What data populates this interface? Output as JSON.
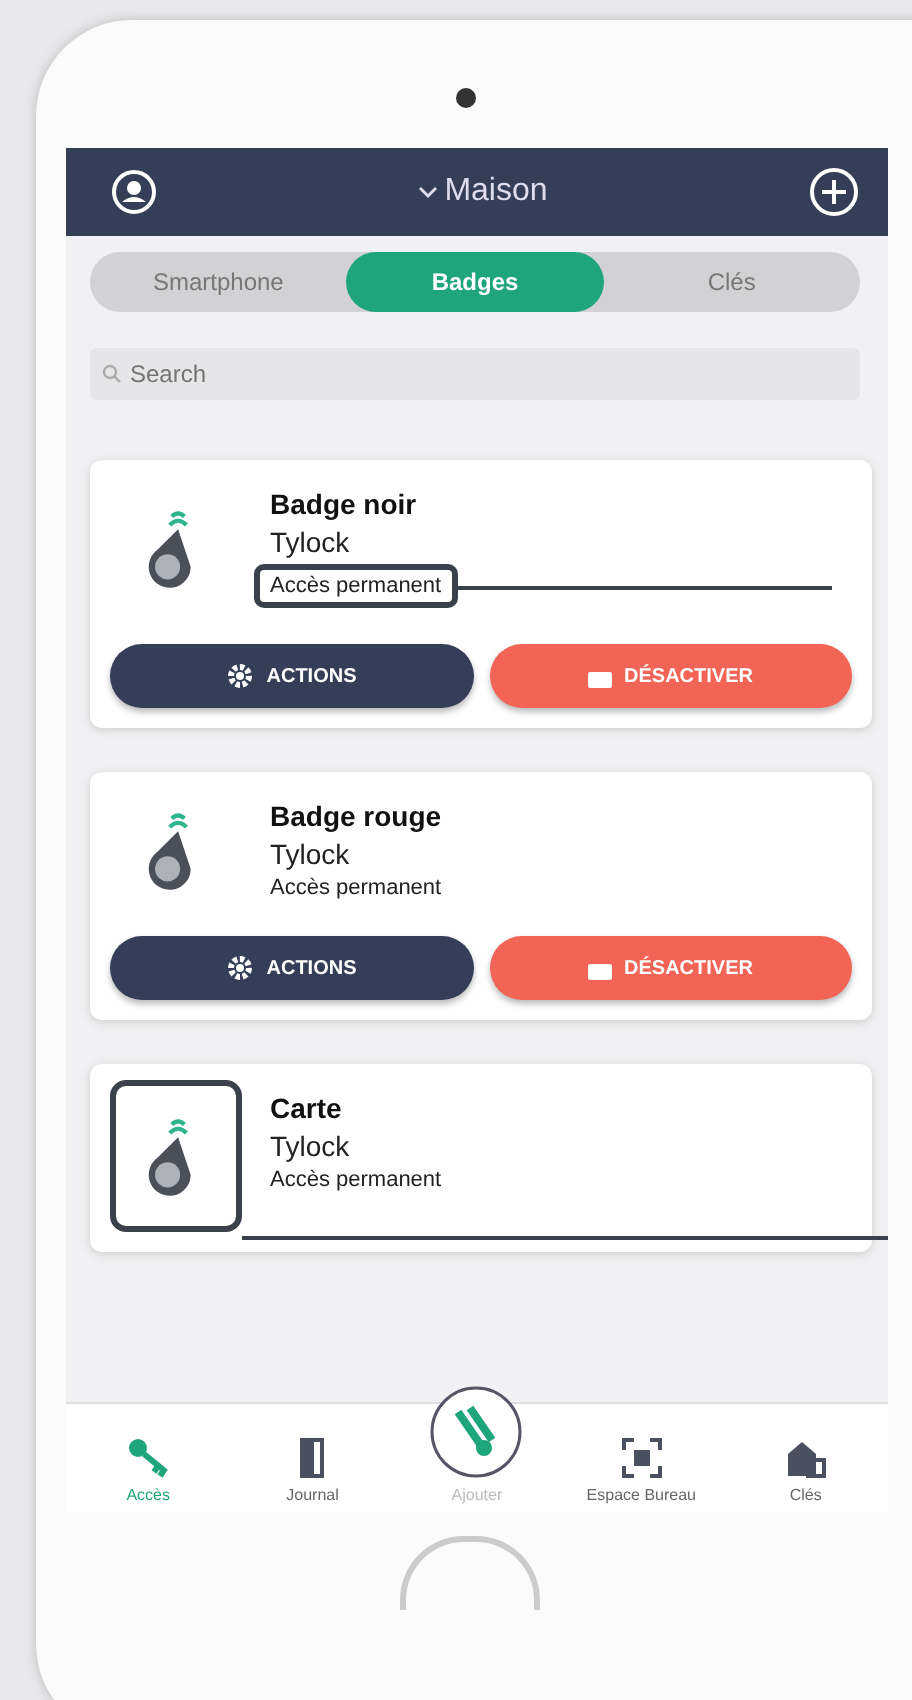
{
  "header": {
    "title": "Maison"
  },
  "tabs": [
    {
      "label": "Smartphone",
      "selected": false
    },
    {
      "label": "Badges",
      "selected": true
    },
    {
      "label": "Clés",
      "selected": false
    }
  ],
  "search": {
    "placeholder": "Search"
  },
  "cards": [
    {
      "name": "Badge noir",
      "brand": "Tylock",
      "access": "Accès permanent",
      "access_highlighted": true,
      "icon_highlighted": false,
      "buttons": [
        {
          "kind": "actions",
          "label": "ACTIONS"
        },
        {
          "kind": "deactivate",
          "label": "DÉSACTIVER"
        }
      ]
    },
    {
      "name": "Badge rouge",
      "brand": "Tylock",
      "access": "Accès permanent",
      "access_highlighted": false,
      "icon_highlighted": false,
      "buttons": [
        {
          "kind": "actions",
          "label": "ACTIONS"
        },
        {
          "kind": "deactivate",
          "label": "DÉSACTIVER"
        }
      ]
    },
    {
      "name": "Carte",
      "brand": "Tylock",
      "access": "Accès permanent",
      "access_highlighted": false,
      "icon_highlighted": true
    }
  ],
  "nav": [
    {
      "kind": "key",
      "label": "Accès",
      "selected": true
    },
    {
      "kind": "door",
      "label": "Journal",
      "selected": false
    },
    {
      "kind": "center",
      "label": "Ajouter",
      "selected": false
    },
    {
      "kind": "scan",
      "label": "Espace Bureau",
      "selected": false
    },
    {
      "kind": "house",
      "label": "Clés",
      "selected": false
    }
  ]
}
